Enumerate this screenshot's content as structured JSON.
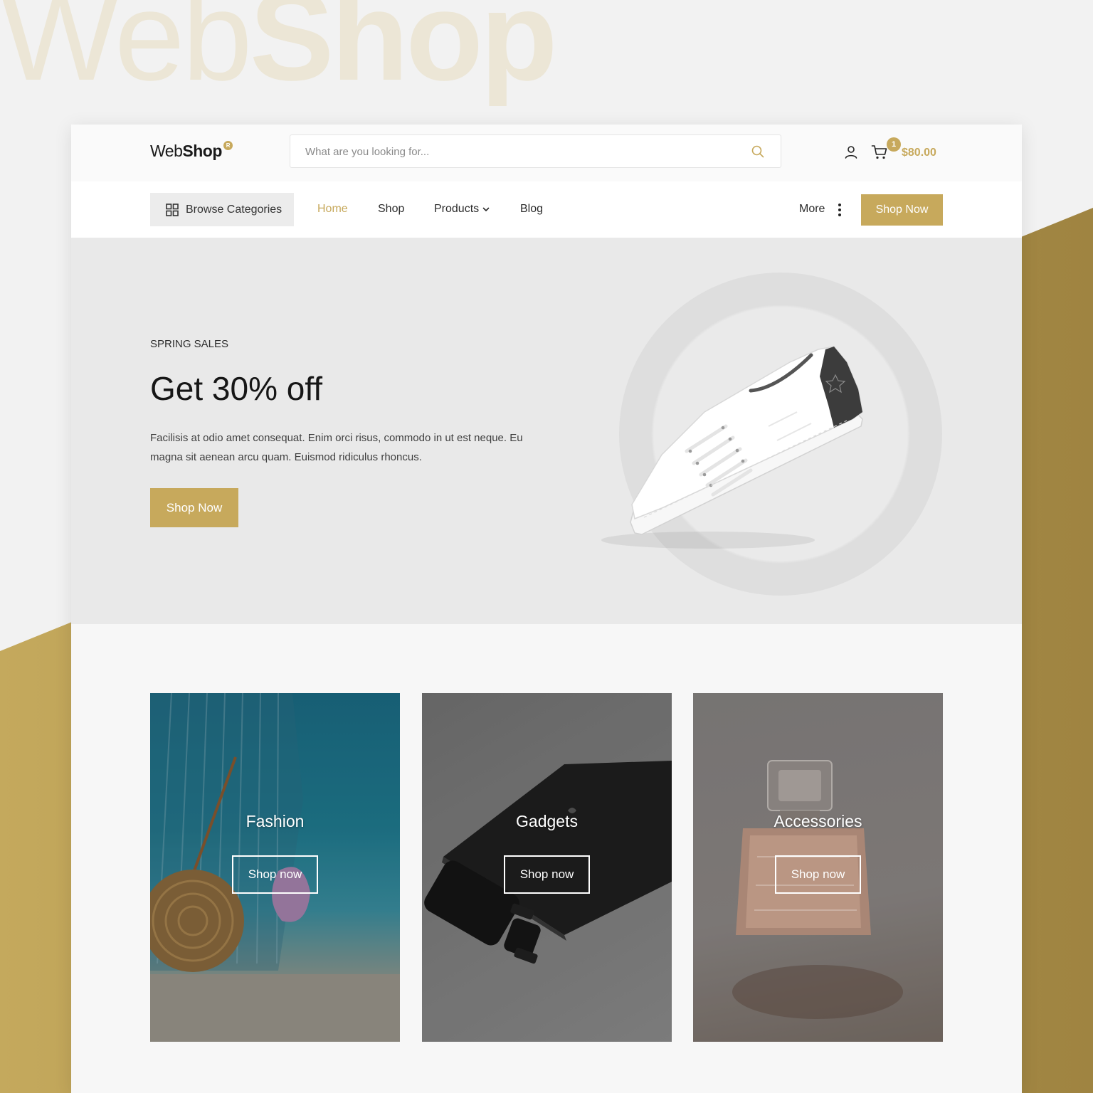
{
  "watermark": {
    "text_light": "Web",
    "text_bold": "Shop"
  },
  "header": {
    "logo_light": "Web",
    "logo_bold": "Shop",
    "logo_badge": "R",
    "search_placeholder": "What are you looking for...",
    "cart_count": "1",
    "cart_total": "$80.00"
  },
  "nav": {
    "browse_label": "Browse Categories",
    "links": [
      {
        "label": "Home",
        "active": true
      },
      {
        "label": "Shop"
      },
      {
        "label": "Products",
        "has_dropdown": true
      },
      {
        "label": "Blog"
      }
    ],
    "more_label": "More",
    "shop_button": "Shop Now"
  },
  "hero": {
    "eyebrow": "SPRING SALES",
    "title": "Get 30% off",
    "text": "Facilisis at odio amet consequat. Enim orci risus, commodo in ut est neque. Eu magna sit aenean arcu quam. Euismod ridiculus rhoncus.",
    "button": "Shop Now"
  },
  "categories": [
    {
      "title": "Fashion",
      "button": "Shop now"
    },
    {
      "title": "Gadgets",
      "button": "Shop now"
    },
    {
      "title": "Accessories",
      "button": "Shop now"
    }
  ],
  "icons": [
    "search-icon",
    "user-icon",
    "cart-icon",
    "grid-icon",
    "chevron-down-icon",
    "more-icon"
  ],
  "colors": {
    "accent": "#c7a95c",
    "gold_background": "#b09248",
    "hero_background": "#e9e9e9"
  }
}
